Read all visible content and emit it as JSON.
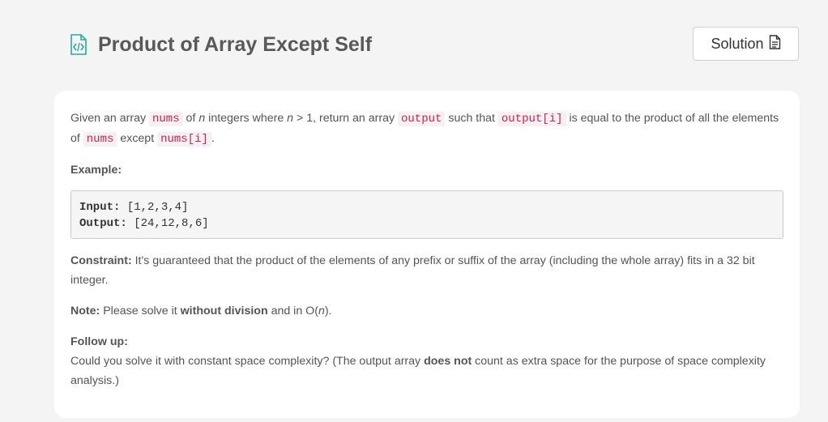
{
  "header": {
    "title": "Product of Array Except Self",
    "solution_label": "Solution"
  },
  "icons": {
    "title_icon": "code-file-icon",
    "solution_icon": "document-icon"
  },
  "description": {
    "p1_a": "Given an array ",
    "code_nums": "nums",
    "p1_b": " of ",
    "p1_n": "n",
    "p1_c": " integers where ",
    "p1_n2": "n",
    "p1_d": " > 1,  return an array ",
    "code_output": "output",
    "p1_e": " such that ",
    "code_output_i": "output[i]",
    "p1_f": " is equal to the product of all the elements of ",
    "code_nums2": "nums",
    "p1_g": " except ",
    "code_nums_i": "nums[i]",
    "p1_h": "."
  },
  "example": {
    "title": "Example:",
    "input_label": "Input:",
    "input_value": "[1,2,3,4]",
    "output_label": "Output:",
    "output_value": "[24,12,8,6]"
  },
  "constraint": {
    "label": "Constraint:",
    "text": " It's guaranteed that the product of the elements of any prefix or suffix of the array (including the whole array) fits in a 32 bit integer."
  },
  "note": {
    "label": "Note:",
    "text_a": " Please solve it ",
    "bold": "without division",
    "text_b": " and in O(",
    "n": "n",
    "text_c": ")."
  },
  "follow_up": {
    "label": "Follow up:",
    "text_a": "Could you solve it with constant space complexity? (The output array ",
    "bold": "does not",
    "text_b": " count as extra space for the purpose of space complexity analysis.)"
  },
  "colors": {
    "accent_icon": "#2aa9a0",
    "code_text": "#c7254e",
    "page_bg": "#f4f4f4"
  }
}
